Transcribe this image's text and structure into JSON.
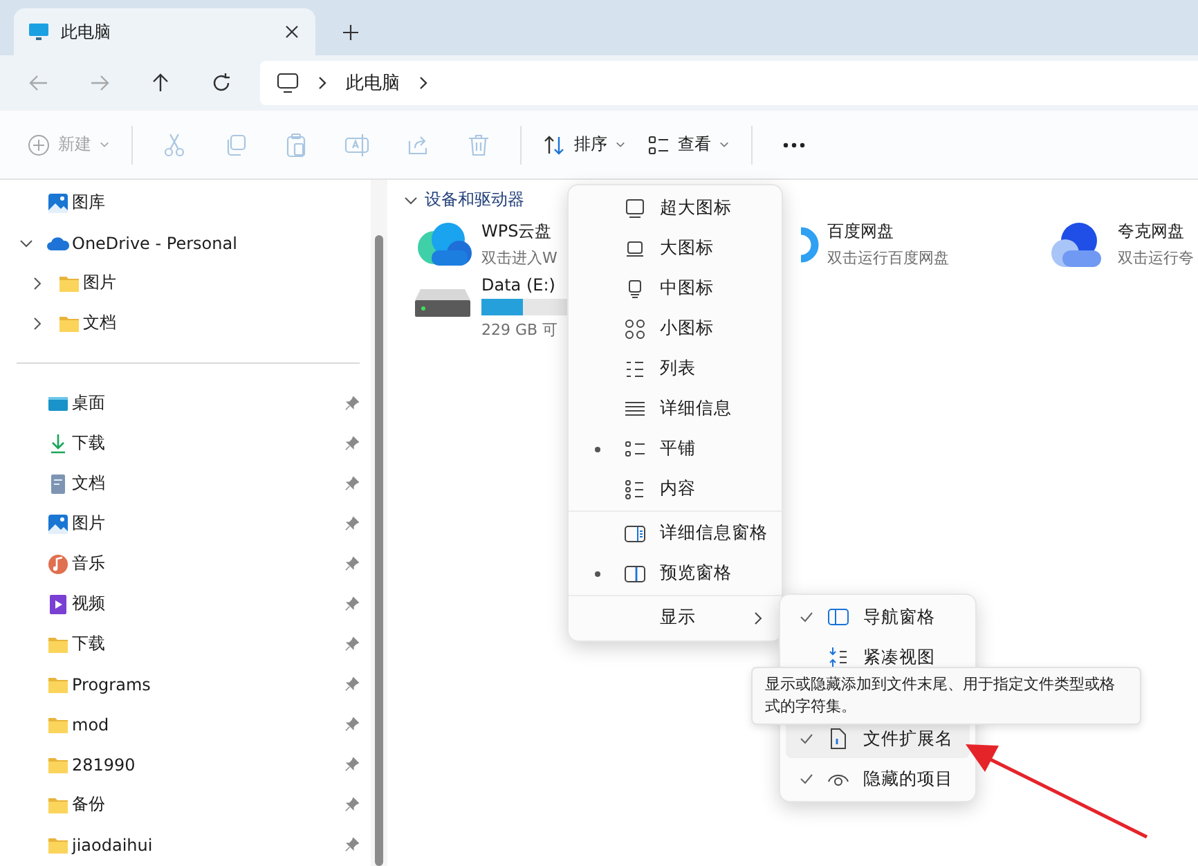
{
  "tabs": [
    {
      "title": "此电脑",
      "selected": true
    }
  ],
  "nav_buttons": [
    {
      "kind": "back",
      "disabled": true
    },
    {
      "kind": "forward",
      "disabled": true
    },
    {
      "kind": "up",
      "disabled": false
    },
    {
      "kind": "refresh",
      "disabled": false
    }
  ],
  "address": {
    "segments": [
      "此电脑"
    ]
  },
  "toolbar": {
    "new": {
      "label": "新建",
      "disabled": true
    },
    "actions": [
      {
        "kind": "cut",
        "disabled": true
      },
      {
        "kind": "copy",
        "disabled": true
      },
      {
        "kind": "paste",
        "disabled": true
      },
      {
        "kind": "rename",
        "disabled": true
      },
      {
        "kind": "share",
        "disabled": true
      },
      {
        "kind": "delete",
        "disabled": true
      }
    ],
    "sort": "排序",
    "view": "查看"
  },
  "sidebar": {
    "tree": [
      {
        "label": "图库",
        "kind": "gallery"
      },
      {
        "label": "OneDrive - Personal",
        "kind": "cloud",
        "expanded": true,
        "children": [
          {
            "label": "图片",
            "kind": "folder",
            "expanded": false
          },
          {
            "label": "文档",
            "kind": "folder",
            "expanded": false
          }
        ]
      }
    ],
    "quick_access": [
      {
        "label": "桌面",
        "kind": "desktop",
        "pinned": true
      },
      {
        "label": "下载",
        "kind": "download",
        "pinned": true
      },
      {
        "label": "文档",
        "kind": "document",
        "pinned": true
      },
      {
        "label": "图片",
        "kind": "gallery",
        "pinned": true
      },
      {
        "label": "音乐",
        "kind": "music",
        "pinned": true
      },
      {
        "label": "视频",
        "kind": "video",
        "pinned": true
      },
      {
        "label": "下载",
        "kind": "folder",
        "pinned": true
      },
      {
        "label": "Programs",
        "kind": "folder",
        "pinned": true
      },
      {
        "label": "mod",
        "kind": "folder",
        "pinned": true
      },
      {
        "label": "281990",
        "kind": "folder",
        "pinned": true
      },
      {
        "label": "备份",
        "kind": "folder",
        "pinned": true
      },
      {
        "label": "jiaodaihui",
        "kind": "folder",
        "pinned": true
      }
    ]
  },
  "content": {
    "section": {
      "title": "设备和驱动器",
      "expanded": true
    },
    "items": [
      {
        "kind": "wps",
        "name": "WPS云盘",
        "detail": "双击进入W"
      },
      {
        "kind": "baidu",
        "name": "百度网盘",
        "detail": "双击运行百度网盘"
      },
      {
        "kind": "quark",
        "name": "夸克网盘",
        "detail": "双击运行夸"
      },
      {
        "kind": "drive",
        "name": "Data (E:)",
        "level": 0.2,
        "detail": "229 GB 可"
      }
    ]
  },
  "view_menu": {
    "groups": [
      [
        {
          "label": "超大图标",
          "kind": "xl",
          "bullet": false
        },
        {
          "label": "大图标",
          "kind": "large",
          "bullet": false
        },
        {
          "label": "中图标",
          "kind": "medium",
          "bullet": false
        },
        {
          "label": "小图标",
          "kind": "small",
          "bullet": false
        },
        {
          "label": "列表",
          "kind": "list",
          "bullet": false
        },
        {
          "label": "详细信息",
          "kind": "details",
          "bullet": false
        },
        {
          "label": "平铺",
          "kind": "tiles",
          "bullet": true
        },
        {
          "label": "内容",
          "kind": "content",
          "bullet": false
        }
      ],
      [
        {
          "label": "详细信息窗格",
          "kind": "detailspane",
          "bullet": false
        },
        {
          "label": "预览窗格",
          "kind": "previewpane",
          "bullet": true
        }
      ],
      [
        {
          "label": "显示",
          "kind": "submenu",
          "bullet": false
        }
      ]
    ]
  },
  "show_menu": {
    "items": [
      {
        "label": "导航窗格",
        "kind": "navpane",
        "checked": true,
        "selected": false
      },
      {
        "label": "紧凑视图",
        "kind": "compact",
        "checked": false,
        "selected": false
      },
      {
        "label": "文件扩展名",
        "kind": "ext",
        "checked": true,
        "selected": true
      },
      {
        "label": "隐藏的项目",
        "kind": "eye",
        "checked": true,
        "selected": false
      }
    ]
  },
  "tooltip": {
    "text": "显示或隐藏添加到文件末尾、用于指定文件类型或格式的字符集。"
  }
}
